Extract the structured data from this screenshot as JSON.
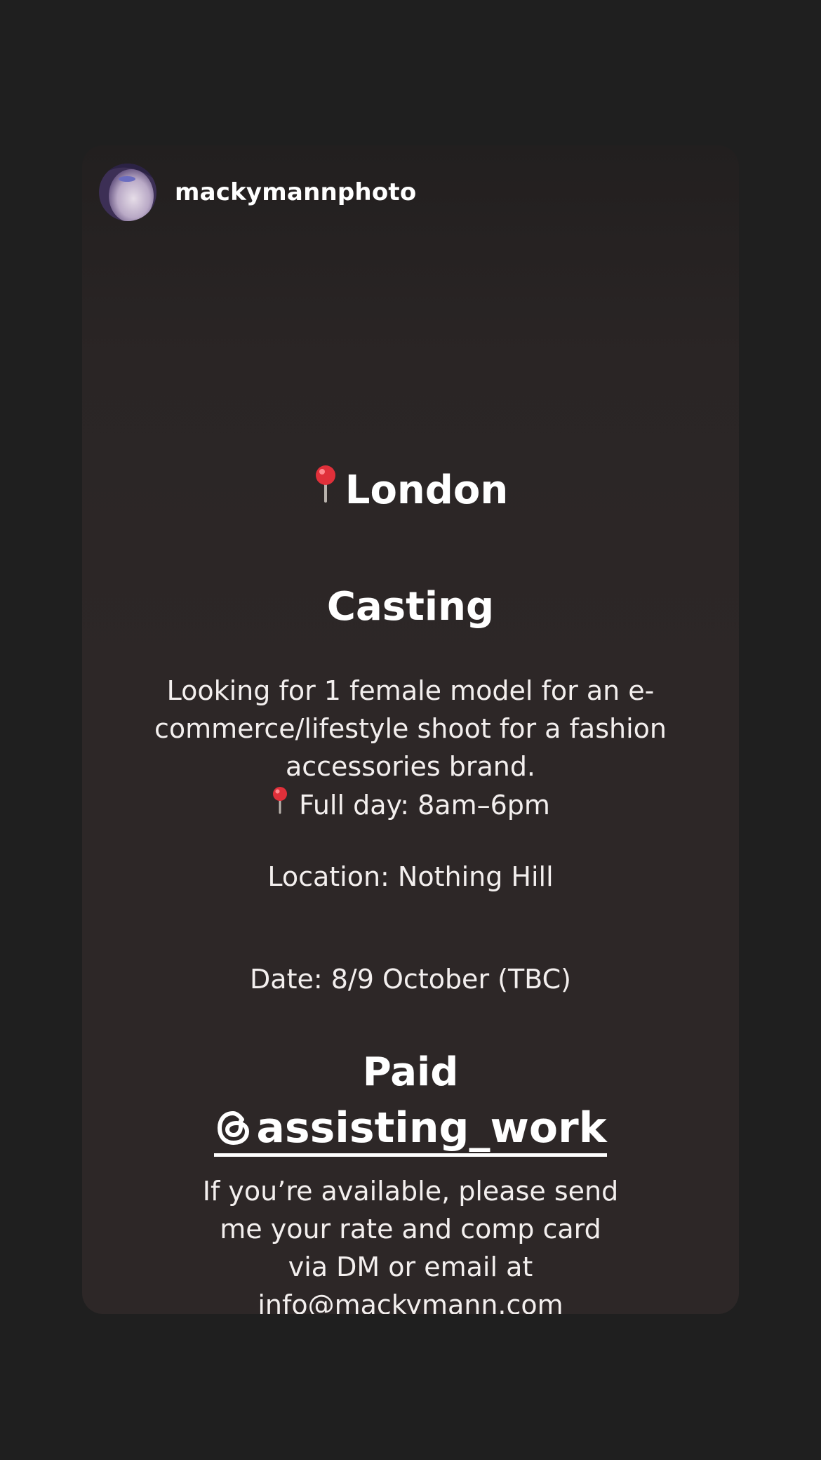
{
  "story": {
    "username": "mackymannphoto",
    "city": "London",
    "heading": "Casting",
    "description_lines": [
      "Looking for 1 female model for an e-",
      "commerce/lifestyle shoot for a fashion",
      "accessories brand."
    ],
    "full_day": "Full day: 8am–6pm",
    "location": "Location: Nothing Hill",
    "date": "Date: 8/9 October (TBC)",
    "paid": "Paid",
    "handle": "assisting_work",
    "cta_lines": [
      "If you’re available, please send",
      "me your rate and comp card",
      "via DM or email at",
      "info@mackymann.com"
    ]
  },
  "icons": {
    "city_pin": "round-pushpin-icon",
    "full_day_pin": "round-pushpin-icon",
    "handle_icon": "threads-icon"
  },
  "colors": {
    "page_background": "#1f1f1f",
    "card_background": "#2d2727",
    "text": "#ffffff",
    "pin_red": "#e0303a"
  }
}
